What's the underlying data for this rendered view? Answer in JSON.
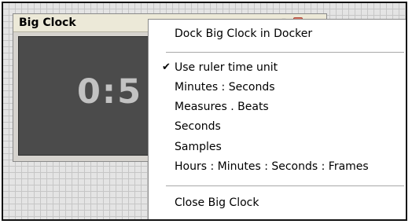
{
  "window": {
    "title": "Big Clock",
    "pin_glyph": "▾",
    "clock_display": "0:5"
  },
  "context_menu": {
    "dock_label": "Dock Big Clock in Docker",
    "check_glyph": "✔",
    "items": [
      {
        "label": "Use ruler time unit",
        "checked": true
      },
      {
        "label": "Minutes : Seconds",
        "checked": false
      },
      {
        "label": "Measures . Beats",
        "checked": false
      },
      {
        "label": "Seconds",
        "checked": false
      },
      {
        "label": "Samples",
        "checked": false
      },
      {
        "label": "Hours : Minutes : Seconds : Frames",
        "checked": false
      }
    ],
    "close_label": "Close Big Clock"
  },
  "icons": {
    "pin": "pin-icon",
    "close": "close-icon",
    "check": "checkmark-icon"
  },
  "colors": {
    "clock_background": "#4b4b4b",
    "clock_text": "#c2c2c2",
    "menu_background": "#ffffff"
  }
}
